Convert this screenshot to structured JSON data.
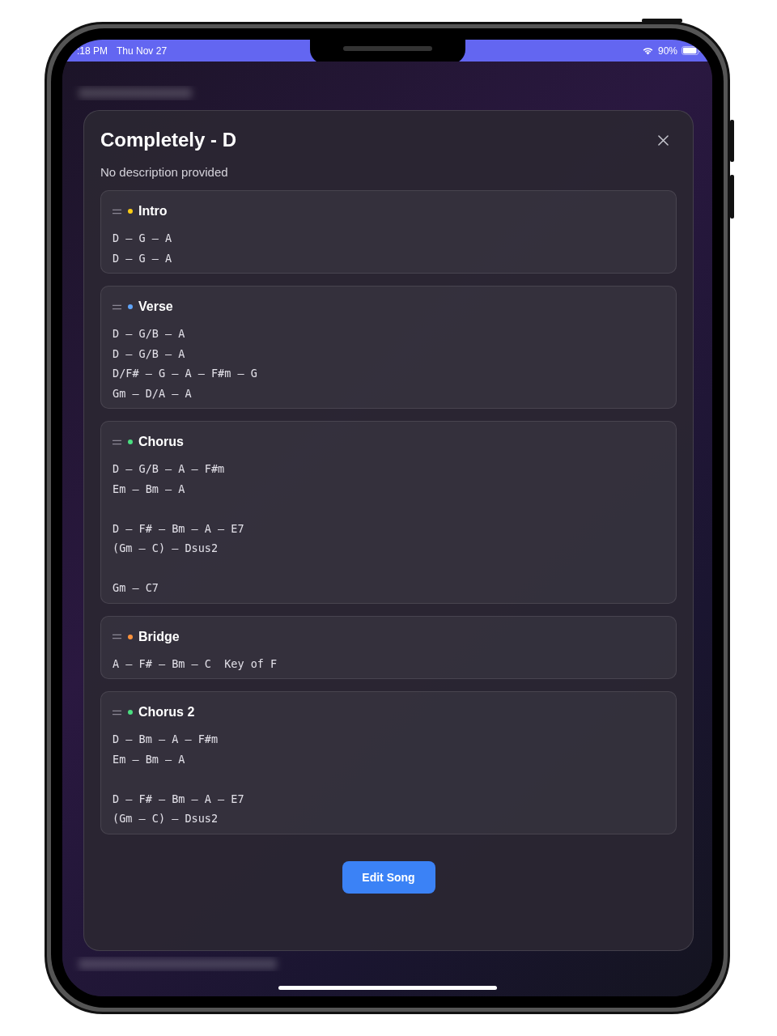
{
  "status_bar": {
    "time": ":18 PM",
    "date": "Thu Nov 27",
    "battery": "90%"
  },
  "modal": {
    "title": "Completely - D",
    "description": "No description provided",
    "sections": [
      {
        "name": "Intro",
        "color": "#facc15",
        "stanzas": [
          [
            "D – G – A",
            "D – G – A"
          ]
        ]
      },
      {
        "name": "Verse",
        "color": "#60a5fa",
        "stanzas": [
          [
            "D – G/B – A",
            "D – G/B – A",
            "D/F# – G – A – F#m – G",
            "Gm – D/A – A"
          ]
        ]
      },
      {
        "name": "Chorus",
        "color": "#4ade80",
        "stanzas": [
          [
            "D – G/B – A – F#m",
            "Em – Bm – A"
          ],
          [
            "D – F# – Bm – A – E7",
            "(Gm – C) – Dsus2"
          ],
          [
            "Gm – C7"
          ]
        ]
      },
      {
        "name": "Bridge",
        "color": "#fb923c",
        "stanzas": [
          [
            "A – F# – Bm – C  Key of F"
          ]
        ]
      },
      {
        "name": "Chorus 2",
        "color": "#4ade80",
        "stanzas": [
          [
            "D – Bm – A – F#m",
            "Em – Bm – A"
          ],
          [
            "D – F# – Bm – A – E7",
            "(Gm – C) – Dsus2"
          ]
        ]
      }
    ],
    "button": "Edit Song"
  }
}
